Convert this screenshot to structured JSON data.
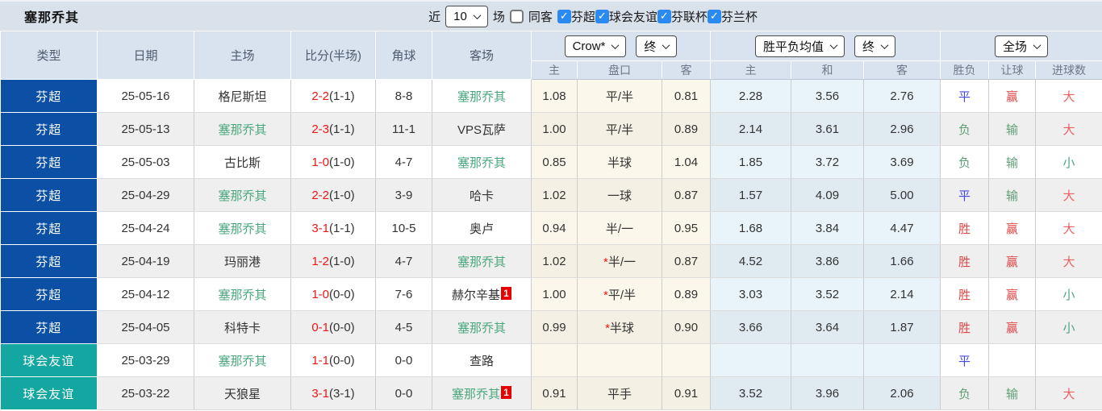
{
  "toolbar": {
    "team_name": "塞那乔其",
    "recent_label": "近",
    "recent_value": "10",
    "matches_label": "场",
    "same_away_label": "同客",
    "same_away_checked": false,
    "filters": [
      {
        "label": "芬超",
        "checked": true
      },
      {
        "label": "球会友谊",
        "checked": true
      },
      {
        "label": "芬联杯",
        "checked": true
      },
      {
        "label": "芬兰杯",
        "checked": true
      }
    ]
  },
  "table": {
    "headers": {
      "type": "类型",
      "date": "日期",
      "home": "主场",
      "score": "比分(半场)",
      "corners": "角球",
      "away": "客场",
      "ah_company_select": "Crow*",
      "ah_time_select": "终",
      "ah_sub": [
        "主",
        "盘口",
        "客"
      ],
      "eu_company_select": "胜平负均值",
      "eu_time_select": "终",
      "eu_sub": [
        "主",
        "和",
        "客"
      ],
      "result_scope_select": "全场",
      "result_sub": [
        "胜负",
        "让球",
        "进球数"
      ]
    },
    "rows": [
      {
        "type": "芬超",
        "type_color": "blue",
        "date": "25-05-16",
        "home": {
          "name": "格尼斯坦",
          "subject": false,
          "badge": ""
        },
        "score_ft": "2-2",
        "score_ht": "(1-1)",
        "corners": "8-8",
        "away": {
          "name": "塞那乔其",
          "subject": true,
          "badge": ""
        },
        "ah": [
          "1.08",
          "平/半",
          "0.81"
        ],
        "eu": [
          "2.28",
          "3.56",
          "2.76"
        ],
        "results": [
          {
            "text": "平",
            "color": "draw"
          },
          {
            "text": "赢",
            "color": "win"
          },
          {
            "text": "大",
            "color": "over"
          }
        ]
      },
      {
        "type": "芬超",
        "type_color": "blue",
        "date": "25-05-13",
        "home": {
          "name": "塞那乔其",
          "subject": true,
          "badge": ""
        },
        "score_ft": "2-3",
        "score_ht": "(1-1)",
        "corners": "11-1",
        "away": {
          "name": "VPS瓦萨",
          "subject": false,
          "badge": ""
        },
        "ah": [
          "1.00",
          "平/半",
          "0.89"
        ],
        "eu": [
          "2.14",
          "3.61",
          "2.96"
        ],
        "results": [
          {
            "text": "负",
            "color": "lose"
          },
          {
            "text": "输",
            "color": "lose"
          },
          {
            "text": "大",
            "color": "over"
          }
        ]
      },
      {
        "type": "芬超",
        "type_color": "blue",
        "date": "25-05-03",
        "home": {
          "name": "古比斯",
          "subject": false,
          "badge": ""
        },
        "score_ft": "1-0",
        "score_ht": "(1-0)",
        "corners": "4-7",
        "away": {
          "name": "塞那乔其",
          "subject": true,
          "badge": ""
        },
        "ah": [
          "0.85",
          "半球",
          "1.04"
        ],
        "eu": [
          "1.85",
          "3.72",
          "3.69"
        ],
        "results": [
          {
            "text": "负",
            "color": "lose"
          },
          {
            "text": "输",
            "color": "lose"
          },
          {
            "text": "小",
            "color": "under"
          }
        ]
      },
      {
        "type": "芬超",
        "type_color": "blue",
        "date": "25-04-29",
        "home": {
          "name": "塞那乔其",
          "subject": true,
          "badge": ""
        },
        "score_ft": "2-2",
        "score_ht": "(1-0)",
        "corners": "3-9",
        "away": {
          "name": "哈卡",
          "subject": false,
          "badge": ""
        },
        "ah": [
          "1.02",
          "一球",
          "0.87"
        ],
        "eu": [
          "1.57",
          "4.09",
          "5.00"
        ],
        "results": [
          {
            "text": "平",
            "color": "draw"
          },
          {
            "text": "输",
            "color": "lose"
          },
          {
            "text": "大",
            "color": "over"
          }
        ]
      },
      {
        "type": "芬超",
        "type_color": "blue",
        "date": "25-04-24",
        "home": {
          "name": "塞那乔其",
          "subject": true,
          "badge": ""
        },
        "score_ft": "3-1",
        "score_ht": "(1-1)",
        "corners": "10-5",
        "away": {
          "name": "奥卢",
          "subject": false,
          "badge": ""
        },
        "ah": [
          "0.94",
          "半/一",
          "0.95"
        ],
        "eu": [
          "1.68",
          "3.84",
          "4.47"
        ],
        "results": [
          {
            "text": "胜",
            "color": "win"
          },
          {
            "text": "赢",
            "color": "win"
          },
          {
            "text": "大",
            "color": "over"
          }
        ]
      },
      {
        "type": "芬超",
        "type_color": "blue",
        "date": "25-04-19",
        "home": {
          "name": "玛丽港",
          "subject": false,
          "badge": ""
        },
        "score_ft": "1-2",
        "score_ht": "(1-0)",
        "corners": "4-7",
        "away": {
          "name": "塞那乔其",
          "subject": true,
          "badge": ""
        },
        "ah": [
          "1.02",
          "*半/一",
          "0.87"
        ],
        "eu": [
          "4.52",
          "3.86",
          "1.66"
        ],
        "results": [
          {
            "text": "胜",
            "color": "win"
          },
          {
            "text": "赢",
            "color": "win"
          },
          {
            "text": "大",
            "color": "over"
          }
        ]
      },
      {
        "type": "芬超",
        "type_color": "blue",
        "date": "25-04-12",
        "home": {
          "name": "塞那乔其",
          "subject": true,
          "badge": ""
        },
        "score_ft": "1-0",
        "score_ht": "(0-0)",
        "corners": "7-6",
        "away": {
          "name": "赫尔辛基",
          "subject": false,
          "badge": "1"
        },
        "ah": [
          "1.00",
          "*平/半",
          "0.89"
        ],
        "eu": [
          "3.03",
          "3.52",
          "2.14"
        ],
        "results": [
          {
            "text": "胜",
            "color": "win"
          },
          {
            "text": "赢",
            "color": "win"
          },
          {
            "text": "小",
            "color": "under"
          }
        ]
      },
      {
        "type": "芬超",
        "type_color": "blue",
        "date": "25-04-05",
        "home": {
          "name": "科特卡",
          "subject": false,
          "badge": ""
        },
        "score_ft": "0-1",
        "score_ht": "(0-0)",
        "corners": "4-5",
        "away": {
          "name": "塞那乔其",
          "subject": true,
          "badge": ""
        },
        "ah": [
          "0.99",
          "*半球",
          "0.90"
        ],
        "eu": [
          "3.66",
          "3.64",
          "1.87"
        ],
        "results": [
          {
            "text": "胜",
            "color": "win"
          },
          {
            "text": "赢",
            "color": "win"
          },
          {
            "text": "小",
            "color": "under"
          }
        ]
      },
      {
        "type": "球会友谊",
        "type_color": "teal",
        "date": "25-03-29",
        "home": {
          "name": "塞那乔其",
          "subject": true,
          "badge": ""
        },
        "score_ft": "1-1",
        "score_ht": "(0-0)",
        "corners": "0-0",
        "away": {
          "name": "查路",
          "subject": false,
          "badge": ""
        },
        "ah": [
          "",
          "",
          ""
        ],
        "eu": [
          "",
          "",
          ""
        ],
        "results": [
          {
            "text": "平",
            "color": "draw"
          },
          {
            "text": "",
            "color": ""
          },
          {
            "text": "",
            "color": ""
          }
        ]
      },
      {
        "type": "球会友谊",
        "type_color": "teal",
        "date": "25-03-22",
        "home": {
          "name": "天狼星",
          "subject": false,
          "badge": ""
        },
        "score_ft": "3-1",
        "score_ht": "(3-1)",
        "corners": "0-0",
        "away": {
          "name": "塞那乔其",
          "subject": true,
          "badge": "1"
        },
        "ah": [
          "0.91",
          "平手",
          "0.91"
        ],
        "eu": [
          "3.52",
          "3.96",
          "2.06"
        ],
        "results": [
          {
            "text": "负",
            "color": "lose"
          },
          {
            "text": "输",
            "color": "lose"
          },
          {
            "text": "大",
            "color": "over"
          }
        ]
      }
    ]
  },
  "colors": {
    "toolbar_bg": "#d9e1ea",
    "header_bg": "#d9e3f0",
    "league_blue": "#0b50a5",
    "league_teal": "#14a7a1",
    "checkbox_blue": "#2b8af0",
    "subject_team_green": "#4aa87e",
    "score_red": "#f01515",
    "badge_red": "#e80000",
    "win_red": "#e04848",
    "draw_blue": "#4848dd",
    "lose_green": "#5e9e74",
    "over_red": "#ef6060",
    "under_green": "#4fa483"
  }
}
